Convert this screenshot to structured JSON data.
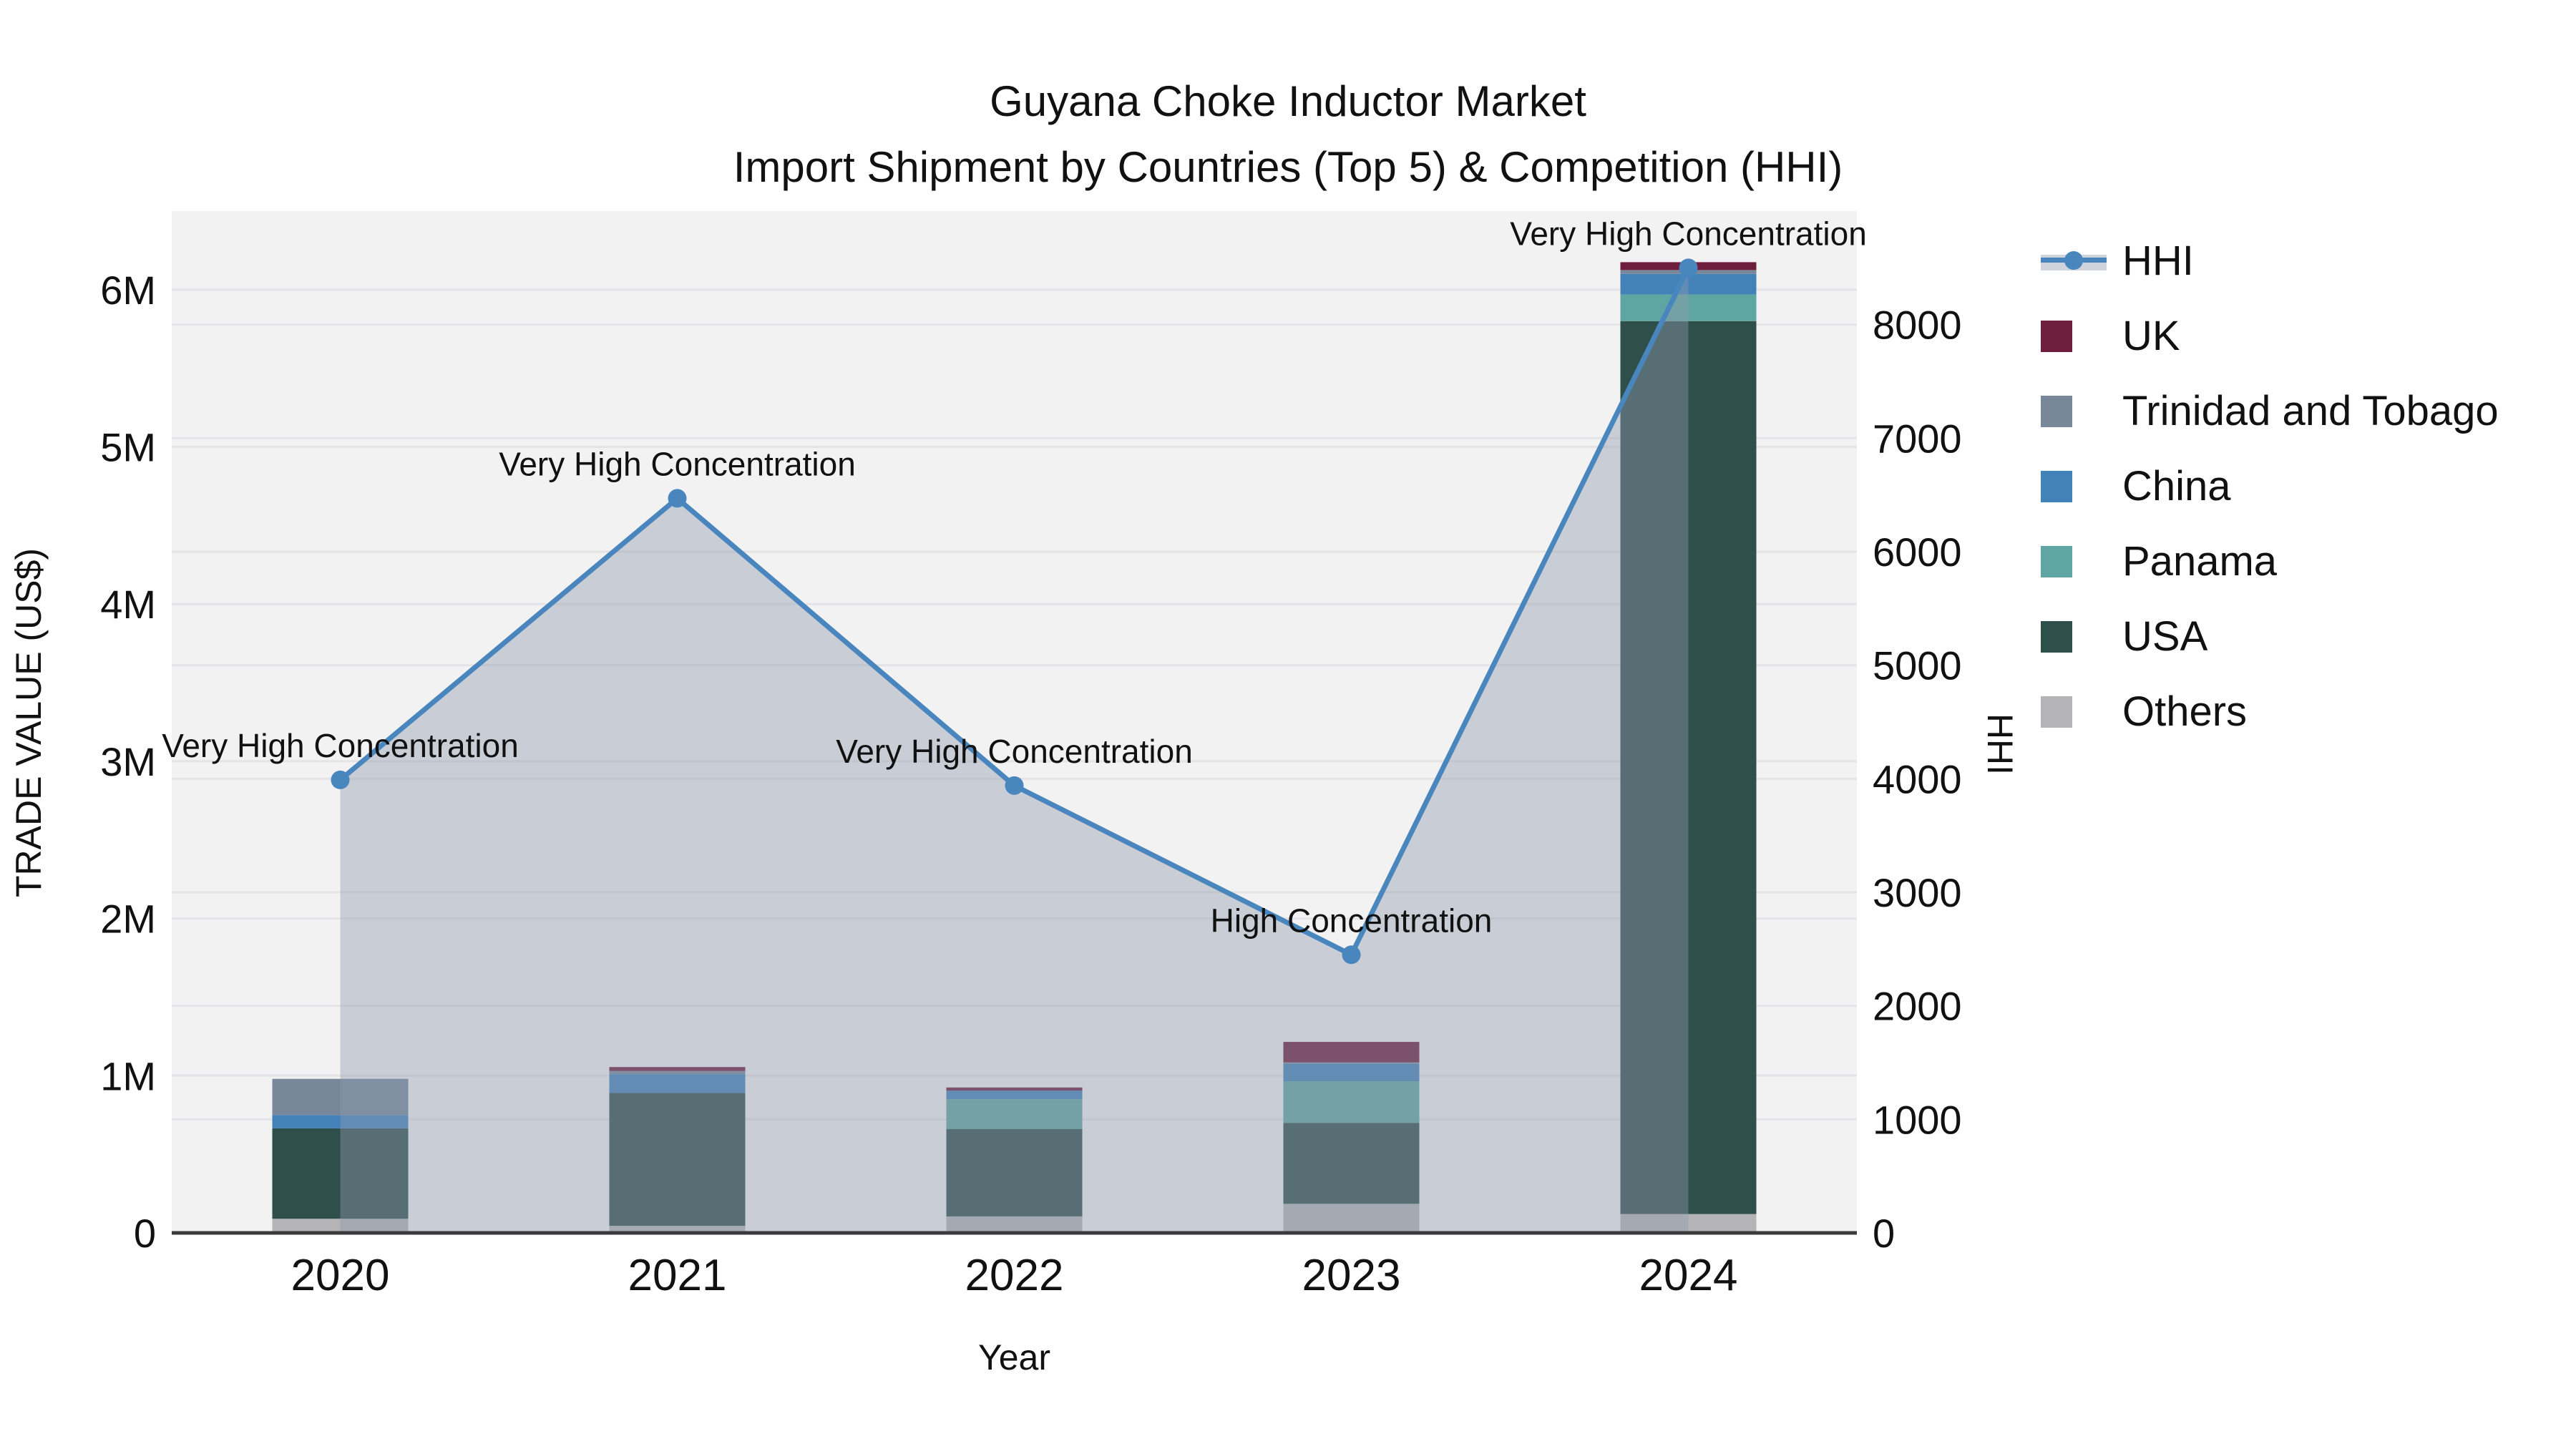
{
  "title": {
    "line1": "Guyana Choke Inductor Market",
    "line2": "Import Shipment by Countries (Top 5) & Competition (HHI)"
  },
  "colors": {
    "hhi_line": "#4a86be",
    "hhi_area_fill": "rgba(142,154,173,0.42)",
    "hhi_legend_band": "#cfd4dc",
    "uk": "#6f1d3d",
    "trinidad_and_tobago": "#78879a",
    "china": "#4381b9",
    "panama": "#5fa5a1",
    "usa": "#2f4f4b",
    "others": "#b4b4b6",
    "plot_bg": "#f2f2f3",
    "grid": "#e4e4e6",
    "axis_line": "#3a3a3a",
    "text": "#111111"
  },
  "legend": {
    "items": [
      {
        "label": "HHI",
        "type": "line"
      },
      {
        "label": "UK",
        "type": "swatch",
        "color": "#6f1d3d"
      },
      {
        "label": "Trinidad and Tobago",
        "type": "swatch",
        "color": "#78879a"
      },
      {
        "label": "China",
        "type": "swatch",
        "color": "#4381b9"
      },
      {
        "label": "Panama",
        "type": "swatch",
        "color": "#5fa5a1"
      },
      {
        "label": "USA",
        "type": "swatch",
        "color": "#2f4f4b"
      },
      {
        "label": "Others",
        "type": "swatch",
        "color": "#b4b4b6"
      }
    ]
  },
  "axes": {
    "left_title": "TRADE VALUE (US$)",
    "right_title": "HHI",
    "x_title": "Year"
  },
  "chart_data": {
    "type": "combo: stacked bar (trade value) + line with area (HHI)",
    "categories": [
      "2020",
      "2021",
      "2022",
      "2023",
      "2024"
    ],
    "left_axis": {
      "title": "TRADE VALUE (US$)",
      "max": 6500000,
      "tick_values": [
        0,
        1000000,
        2000000,
        3000000,
        4000000,
        5000000,
        6000000
      ],
      "tick_labels": [
        "0",
        "1M",
        "2M",
        "3M",
        "4M",
        "5M",
        "6M"
      ]
    },
    "right_axis": {
      "title": "HHI",
      "max": 9000,
      "tick_values": [
        0,
        1000,
        2000,
        3000,
        4000,
        5000,
        6000,
        7000,
        8000
      ],
      "tick_labels": [
        "0",
        "1000",
        "2000",
        "3000",
        "4000",
        "5000",
        "6000",
        "7000",
        "8000"
      ]
    },
    "x_axis": {
      "title": "Year"
    },
    "grid": true,
    "legend_position": "right",
    "series": [
      {
        "name": "Others",
        "color": "#b4b4b6",
        "values": [
          90000,
          45000,
          105000,
          185000,
          120000
        ]
      },
      {
        "name": "USA",
        "color": "#2f4f4b",
        "values": [
          575000,
          845000,
          555000,
          515000,
          5680000
        ]
      },
      {
        "name": "Panama",
        "color": "#5fa5a1",
        "values": [
          0,
          0,
          190000,
          265000,
          170000
        ]
      },
      {
        "name": "China",
        "color": "#4381b9",
        "values": [
          85000,
          120000,
          55000,
          110000,
          130000
        ]
      },
      {
        "name": "Trinidad and Tobago",
        "color": "#78879a",
        "values": [
          230000,
          20000,
          0,
          10000,
          25000
        ]
      },
      {
        "name": "UK",
        "color": "#6f1d3d",
        "values": [
          0,
          25000,
          20000,
          130000,
          50000
        ]
      }
    ],
    "hhi": {
      "name": "HHI",
      "color": "#4a86be",
      "area_fill": "rgba(142,154,173,0.42)",
      "values": [
        3990,
        6470,
        3940,
        2450,
        8500
      ],
      "annotations": [
        "Very High Concentration",
        "Very High Concentration",
        "Very High Concentration",
        "High Concentration",
        "Very High Concentration"
      ]
    }
  }
}
